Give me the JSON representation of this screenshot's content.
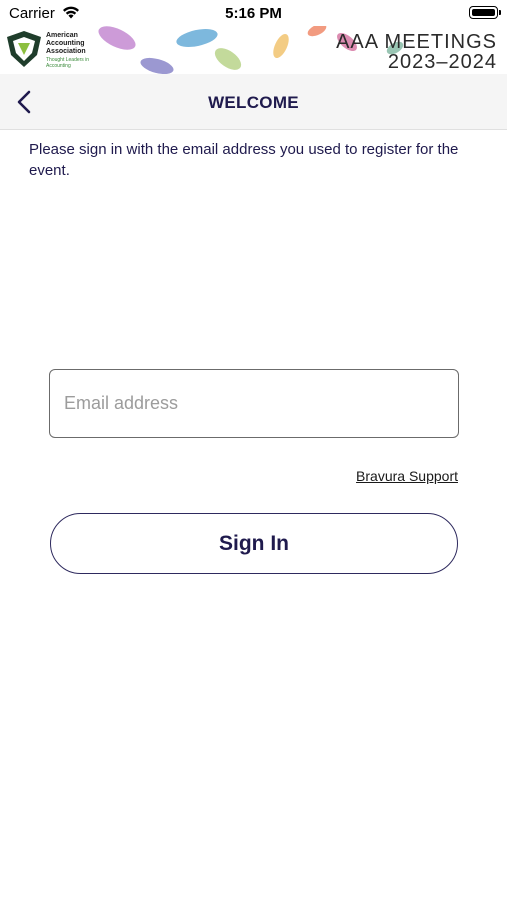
{
  "status_bar": {
    "carrier": "Carrier",
    "time": "5:16 PM"
  },
  "banner": {
    "org_name": "American Accounting Association",
    "org_tagline": "Thought Leaders in Accounting",
    "meeting_title": "AAA MEETINGS",
    "meeting_years": "2023–2024"
  },
  "nav": {
    "title": "WELCOME"
  },
  "main": {
    "instructions": "Please sign in with the email address you used to register for the event.",
    "email_placeholder": "Email address",
    "email_value": "",
    "support_link": "Bravura Support",
    "sign_in_label": "Sign In"
  }
}
